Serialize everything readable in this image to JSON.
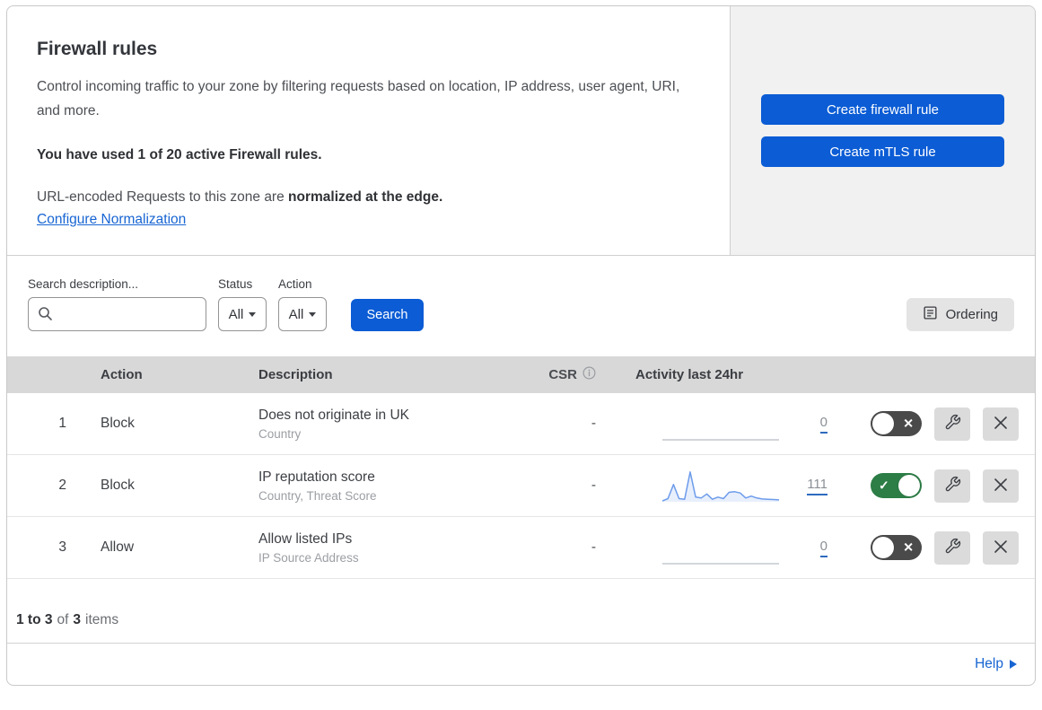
{
  "header": {
    "title": "Firewall rules",
    "description": "Control incoming traffic to your zone by filtering requests based on location, IP address, user agent, URI, and more.",
    "usage_notice": "You have used 1 of 20 active Firewall rules.",
    "normalization_text": "URL-encoded Requests to this zone are ",
    "normalization_bold": "normalized at the edge.",
    "normalization_link": "Configure Normalization",
    "buttons": {
      "create_firewall_rule": "Create firewall rule",
      "create_mtls_rule": "Create mTLS rule"
    }
  },
  "filters": {
    "search_label": "Search description...",
    "search_value": "",
    "status_label": "Status",
    "status_value": "All",
    "action_label": "Action",
    "action_value": "All",
    "search_button": "Search",
    "ordering_button": "Ordering"
  },
  "table": {
    "columns": {
      "action": "Action",
      "description": "Description",
      "csr": "CSR",
      "activity": "Activity last 24hr"
    },
    "rows": [
      {
        "priority": "1",
        "action": "Block",
        "description": "Does not originate in UK",
        "criteria": "Country",
        "csr": "-",
        "activity_count": "0",
        "enabled": false
      },
      {
        "priority": "2",
        "action": "Block",
        "description": "IP reputation score",
        "criteria": "Country, Threat Score",
        "csr": "-",
        "activity_count": "111",
        "enabled": true
      },
      {
        "priority": "3",
        "action": "Allow",
        "description": "Allow listed IPs",
        "criteria": "IP Source Address",
        "csr": "-",
        "activity_count": "0",
        "enabled": false
      }
    ],
    "footer_count": {
      "range": "1 to 3",
      "of": "of",
      "total": "3",
      "items": "items"
    }
  },
  "help": {
    "label": "Help"
  },
  "chart_data": {
    "type": "line",
    "title": "Activity last 24hr",
    "x_range_hours": 24,
    "ylim": [
      0,
      100
    ],
    "grid": false,
    "legend": "none",
    "series": [
      {
        "name": "Does not originate in UK",
        "total": 0,
        "values": [
          0,
          0,
          0,
          0,
          0,
          0,
          0,
          0,
          0,
          0,
          0,
          0,
          0,
          0,
          0,
          0,
          0,
          0,
          0,
          0,
          0,
          0
        ]
      },
      {
        "name": "IP reputation score",
        "total": 111,
        "values": [
          3,
          10,
          55,
          10,
          8,
          95,
          15,
          12,
          25,
          8,
          15,
          10,
          30,
          32,
          28,
          12,
          18,
          12,
          9,
          8,
          7,
          6
        ]
      },
      {
        "name": "Allow listed IPs",
        "total": 0,
        "values": [
          0,
          0,
          0,
          0,
          0,
          0,
          0,
          0,
          0,
          0,
          0,
          0,
          0,
          0,
          0,
          0,
          0,
          0,
          0,
          0,
          0,
          0
        ]
      }
    ]
  },
  "colors": {
    "accent_blue": "#0b5cd5",
    "link_blue": "#1765d2",
    "toggle_on_green": "#2c7d46",
    "toggle_off_gray": "#4a4a4a",
    "sparkline_blue": "#6d9ceb",
    "table_header_gray": "#d8d8d8",
    "side_panel_gray": "#f1f1f1"
  }
}
